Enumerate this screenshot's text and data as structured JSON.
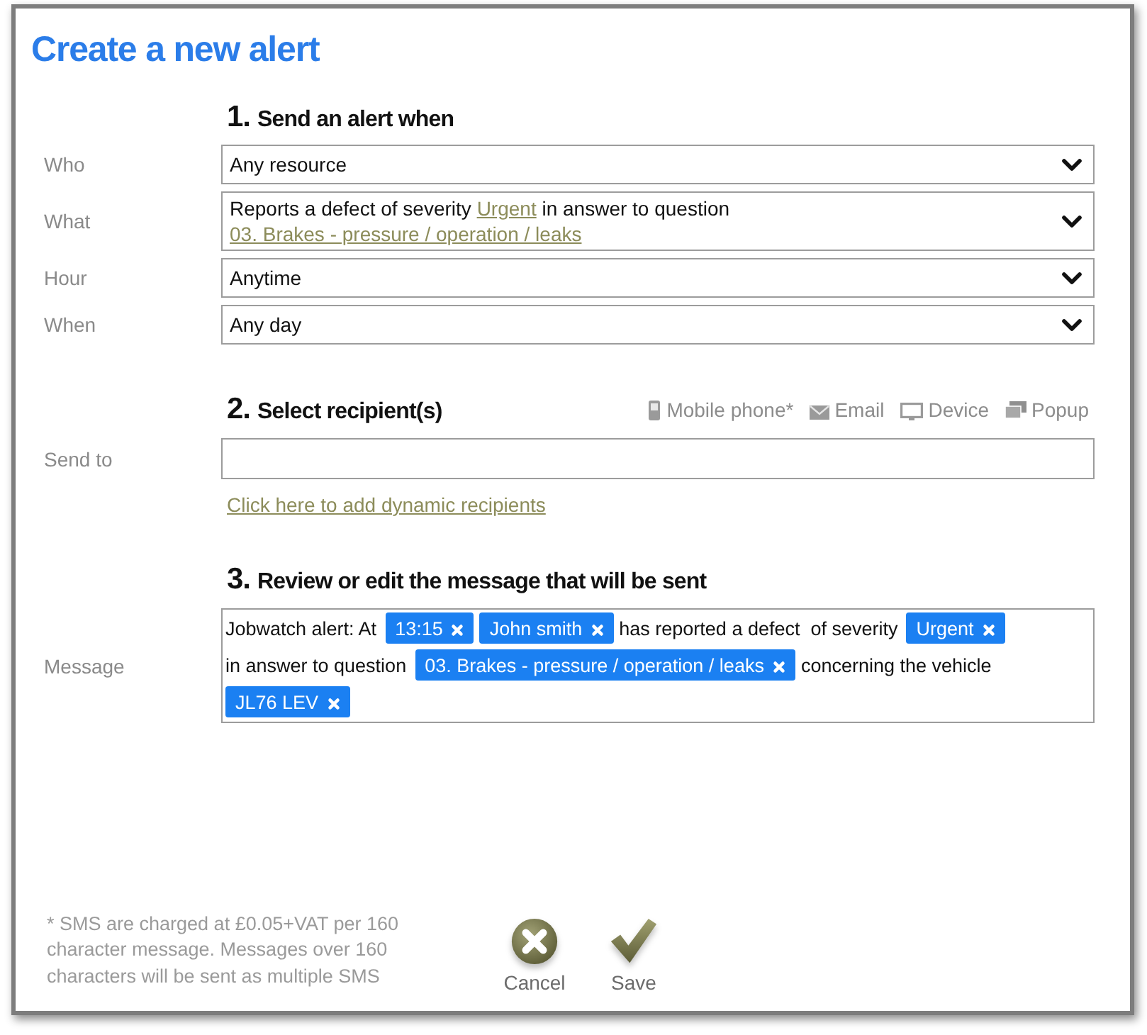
{
  "dialog": {
    "title": "Create a new alert"
  },
  "section_1": {
    "number": "1.",
    "heading": "Send an alert when",
    "rows": [
      {
        "label": "Who",
        "lines": [
          [
            {
              "kind": "text",
              "text": "Any resource"
            }
          ]
        ]
      },
      {
        "label": "What",
        "lines": [
          [
            {
              "kind": "text",
              "text": "Reports a defect of severity "
            },
            {
              "kind": "link",
              "text": "Urgent"
            },
            {
              "kind": "text",
              "text": " in answer to question"
            }
          ],
          [
            {
              "kind": "link",
              "text": "03. Brakes - pressure / operation / leaks"
            }
          ]
        ]
      },
      {
        "label": "Hour",
        "lines": [
          [
            {
              "kind": "text",
              "text": "Anytime"
            }
          ]
        ]
      },
      {
        "label": "When",
        "lines": [
          [
            {
              "kind": "text",
              "text": "Any day"
            }
          ]
        ]
      }
    ]
  },
  "section_2": {
    "number": "2.",
    "heading": "Select recipient(s)",
    "channels": [
      {
        "kind": "mobile",
        "label": "Mobile phone*"
      },
      {
        "kind": "email",
        "label": "Email"
      },
      {
        "kind": "device",
        "label": "Device"
      },
      {
        "kind": "popup",
        "label": "Popup"
      }
    ],
    "send_to": {
      "label": "Send to"
    },
    "dynamic_link": "Click here to add dynamic recipients"
  },
  "section_3": {
    "number": "3.",
    "heading": "Review or edit the message that will be sent",
    "message": {
      "label": "Message",
      "parts": [
        {
          "kind": "text",
          "text": "Jobwatch alert: At"
        },
        {
          "kind": "tag",
          "text": "13:15"
        },
        {
          "kind": "tag",
          "text": "John smith"
        },
        {
          "kind": "text",
          "text": "has reported a defect  of severity"
        },
        {
          "kind": "tag",
          "text": "Urgent"
        },
        {
          "kind": "text",
          "text": "in answer to question"
        },
        {
          "kind": "tag",
          "text": "03. Brakes - pressure / operation / leaks"
        },
        {
          "kind": "text",
          "text": "concerning the vehicle"
        },
        {
          "kind": "tag",
          "text": "JL76 LEV"
        }
      ]
    }
  },
  "footer": {
    "note": "* SMS are charged at £0.05+VAT per 160 character message. Messages over 160 characters will be sent as multiple SMS",
    "buttons": [
      {
        "kind": "cancel",
        "label": "Cancel"
      },
      {
        "kind": "save",
        "label": "Save"
      }
    ]
  }
}
